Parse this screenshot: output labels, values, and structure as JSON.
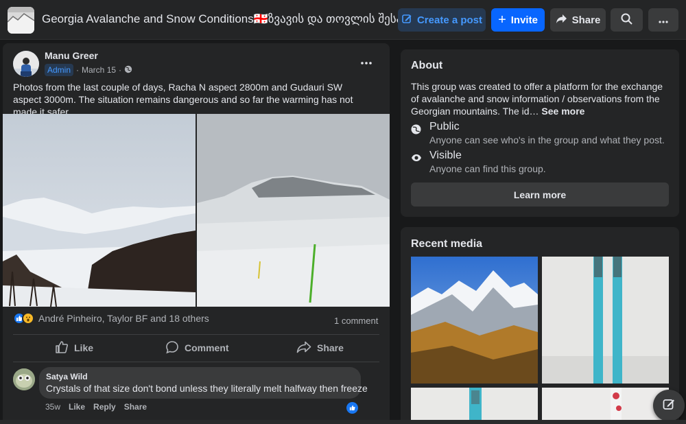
{
  "header": {
    "group_title": "Georgia Avalanche and Snow Conditions🇬🇪ზვავის და თოვლის შესახებ",
    "create_post_label": "Create a post",
    "invite_label": "Invite",
    "share_label": "Share",
    "search_icon": "search-icon",
    "more_icon": "more-horizontal-icon"
  },
  "post": {
    "author": "Manu Greer",
    "badge": "Admin",
    "date": "March 15",
    "separator": "·",
    "audience_icon": "globe-icon",
    "text": "Photos from the last couple of days, Racha N aspect 2800m and Gudauri SW aspect 3000m. The situation remains dangerous and so far the warming has not made it safer.",
    "reactions_text": "André Pinheiro, Taylor BF and 18 others",
    "comment_count": "1 comment",
    "actions": {
      "like": "Like",
      "comment": "Comment",
      "share": "Share"
    },
    "comment": {
      "author": "Satya Wild",
      "text": "Crystals of that size don't bond unless they literally melt halfway then freeze",
      "age": "35w",
      "like": "Like",
      "reply": "Reply",
      "share": "Share"
    }
  },
  "about": {
    "title": "About",
    "description": "This group was created to offer a platform for the exchange of avalanche and snow information / observations from the Georgian mountains. The id…",
    "see_more": "See more",
    "public_title": "Public",
    "public_desc": "Anyone can see who's in the group and what they post.",
    "visible_title": "Visible",
    "visible_desc": "Anyone can find this group.",
    "learn_more": "Learn more"
  },
  "recent_media": {
    "title": "Recent media"
  },
  "colors": {
    "background": "#18191a",
    "card": "#242526",
    "accent": "#0866ff",
    "text": "#e4e6eb",
    "muted": "#b0b3b8"
  }
}
